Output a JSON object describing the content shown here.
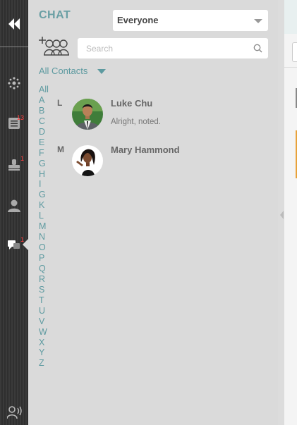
{
  "panel": {
    "title": "CHAT",
    "audience_select": "Everyone",
    "search_placeholder": "Search",
    "filter_label": "All Contacts"
  },
  "alphabet": [
    "All",
    "A",
    "B",
    "C",
    "D",
    "E",
    "F",
    "G",
    "H",
    "I",
    "G",
    "K",
    "L",
    "M",
    "N",
    "O",
    "P",
    "Q",
    "R",
    "S",
    "T",
    "U",
    "V",
    "W",
    "X",
    "Y",
    "Z"
  ],
  "contacts": [
    {
      "group": "L",
      "name": "Luke Chu",
      "last_message": "Alright, noted."
    },
    {
      "group": "M",
      "name": "Mary Hammond",
      "last_message": ""
    }
  ],
  "rail": {
    "badges": {
      "tasks": "13",
      "approvals": "1",
      "chat": "1"
    }
  },
  "colors": {
    "accent": "#5d9aa0",
    "badge": "#ff4040",
    "rail": "#333333"
  }
}
